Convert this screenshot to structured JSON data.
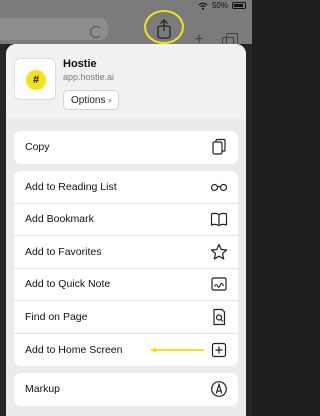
{
  "status": {
    "battery": "50%"
  },
  "app": {
    "name": "Hostie",
    "url": "app.hostie.ai",
    "logo_text": "#",
    "options_label": "Options"
  },
  "actions": {
    "copy": "Copy",
    "list": [
      "Add to Reading List",
      "Add Bookmark",
      "Add to Favorites",
      "Add to Quick Note",
      "Find on Page",
      "Add to Home Screen"
    ],
    "markup": "Markup"
  },
  "colors": {
    "highlight": "#f2e31b",
    "logo_bg": "#f6e21b"
  }
}
